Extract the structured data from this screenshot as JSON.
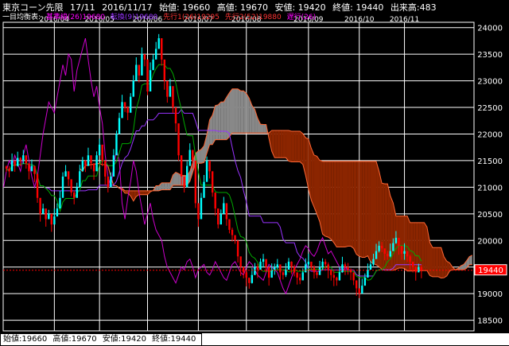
{
  "header": {
    "symbol": "東京コーン先限",
    "contract": "17/11",
    "date": "2016/11/17",
    "open": "始値: 19660",
    "high": "高値: 19670",
    "low": "安値: 19420",
    "close": "終値: 19440",
    "volume": "出来高:483"
  },
  "legend": {
    "title": "一目均衡表:",
    "items": [
      {
        "label": "基準線(26)19680",
        "color": "#ff00ff"
      },
      {
        "label": "転換(9)19680",
        "color": "#9933ff"
      },
      {
        "label": "先行1(26)19295",
        "color": "#ff3333"
      },
      {
        "label": "先行2(52)19880",
        "color": "#ff3333"
      },
      {
        "label": "遅行(26)",
        "color": "#ff00ff"
      }
    ]
  },
  "price_label": "19440",
  "footer": {
    "open": "始値:19660",
    "high": "高値:19670",
    "low": "安値:19420",
    "close": "終値:19440"
  },
  "colors": {
    "background": "#000000",
    "grid": "#ffffff",
    "up_candle": "#00ffff",
    "down_candle": "#ff0000",
    "kijun": "#9933ff",
    "tenkan": "#00aa00",
    "chikou": "#cc00cc",
    "senkou_a": "#ff6633",
    "senkou_b": "#ff6633",
    "cloud_bull": "#888888",
    "cloud_bear": "#8b2500",
    "price_box": "#ff0000"
  },
  "chart_data": {
    "type": "candlestick",
    "title": "東京コーン先限",
    "x_labels": [
      "2016/04",
      "2016/05",
      "2016/06",
      "2016/07",
      "2016/08",
      "2016/09",
      "2016/10",
      "2016/11"
    ],
    "y_ticks": [
      18500,
      19000,
      19500,
      20000,
      20500,
      21000,
      21500,
      22000,
      22500,
      23000,
      23500,
      24000
    ],
    "ylim": [
      18300,
      24100
    ],
    "grid": true,
    "last_price": 19440,
    "ichimoku": {
      "tenkan_period": 9,
      "kijun_period": 26,
      "senkou_b_period": 52,
      "displacement": 26
    },
    "closes": [
      21350,
      21300,
      21500,
      21400,
      21550,
      21500,
      21600,
      21450,
      21300,
      21400,
      21250,
      20800,
      20500,
      20600,
      20400,
      20500,
      20300,
      20450,
      20600,
      20800,
      21200,
      21300,
      21150,
      20900,
      20800,
      21000,
      21300,
      21500,
      21400,
      21600,
      21450,
      21300,
      21600,
      21800,
      21500,
      21200,
      21000,
      21200,
      21600,
      22000,
      22300,
      22600,
      22500,
      22400,
      22700,
      23000,
      23300,
      23100,
      23500,
      23400,
      22800,
      23200,
      23400,
      23600,
      23800,
      23400,
      23000,
      22700,
      22900,
      22500,
      22200,
      21600,
      21200,
      21000,
      21400,
      21700,
      21500,
      20700,
      20400,
      20800,
      21100,
      21500,
      21300,
      20900,
      20600,
      20300,
      20500,
      20700,
      20400,
      20200,
      20100,
      20000,
      19700,
      19500,
      19400,
      19300,
      19200,
      19350,
      19500,
      19450,
      19600,
      19650,
      19500,
      19300,
      19450,
      19500,
      19550,
      19400,
      19350,
      19450,
      19600,
      19500,
      19400,
      19300,
      19250,
      19400,
      19550,
      19600,
      19500,
      19400,
      19350,
      19500,
      19600,
      19550,
      19450,
      19350,
      19300,
      19250,
      19400,
      19550,
      19500,
      19450,
      19400,
      19250,
      19100,
      19000,
      19150,
      19300,
      19450,
      19550,
      19650,
      19800,
      19900,
      19850,
      19750,
      19700,
      19800,
      19950,
      20050,
      19900,
      19750,
      19800,
      19700,
      19600,
      19500,
      19400,
      19500,
      19440
    ]
  }
}
